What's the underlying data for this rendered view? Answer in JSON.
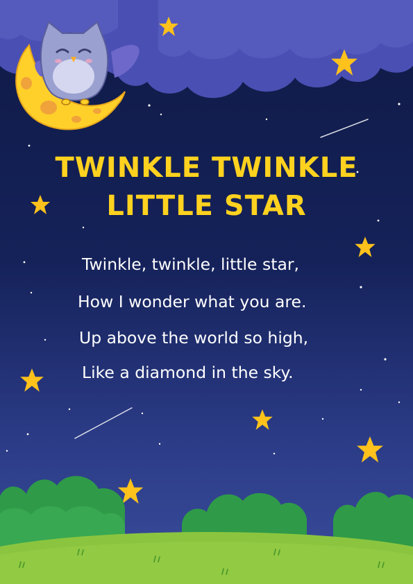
{
  "poster": {
    "title_lines": [
      "TWINKLE TWINKLE",
      "LITTLE STAR"
    ],
    "verse_lines": [
      "Twinkle, twinkle, little star,",
      "How I wonder what you are.",
      "Up above the world so high,",
      "Like a diamond in the sky."
    ]
  },
  "colors": {
    "sky_top": "#0f1a45",
    "sky_bottom": "#3a4d9c",
    "cloud": "#4a4fb3",
    "title": "#ffd21f",
    "star": "#ffc21c",
    "moon": "#ffd02a",
    "moon_crater": "#f0a33a",
    "owl": "#9aa0d0",
    "bush": "#2f9a48",
    "grass": "#8bc53f"
  },
  "icons": [
    "moon-icon",
    "owl-icon",
    "star-icon",
    "shooting-star-icon",
    "cloud-icon",
    "bush-icon"
  ]
}
